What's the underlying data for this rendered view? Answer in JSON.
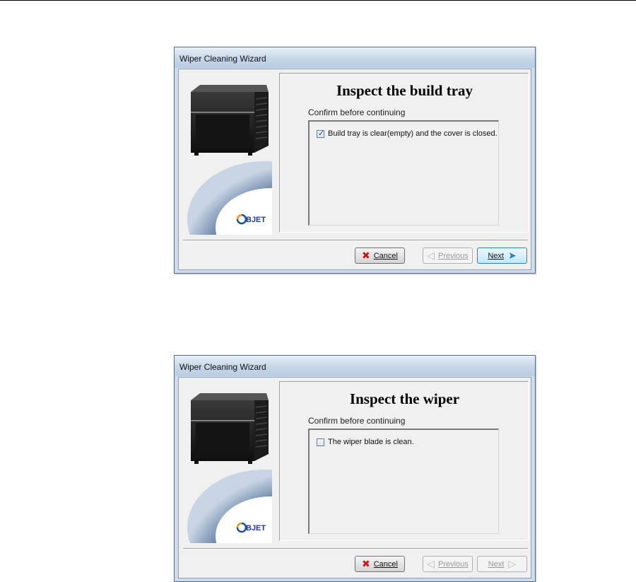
{
  "wizards": [
    {
      "window_title": "Wiper Cleaning Wizard",
      "heading": "Inspect the build tray",
      "confirm_label": "Confirm before continuing",
      "checkbox_text": "Build tray is clear(empty) and the cover is closed.",
      "checkbox_checked": true,
      "cancel_label": "Cancel",
      "previous_label": "Previous",
      "next_label": "Next",
      "previous_enabled": false,
      "next_enabled": true,
      "logo_text": "OBJET"
    },
    {
      "window_title": "Wiper Cleaning Wizard",
      "heading": "Inspect the wiper",
      "confirm_label": "Confirm before continuing",
      "checkbox_text": "The wiper blade is clean.",
      "checkbox_checked": false,
      "cancel_label": "Cancel",
      "previous_label": "Previous",
      "next_label": "Next",
      "previous_enabled": false,
      "next_enabled": false,
      "logo_text": "OBJET"
    }
  ],
  "icons": {
    "cancel": "red-x-icon",
    "previous": "left-arrow-icon",
    "next": "right-arrow-icon",
    "checkbox_tick": "checkmark-icon"
  },
  "colors": {
    "titlebar": "#c6d6e8",
    "dialog_background": "#f0f0f0",
    "cancel_icon": "#c8191b",
    "next_icon": "#2a78c8",
    "disabled_text": "#9a9a9a"
  }
}
